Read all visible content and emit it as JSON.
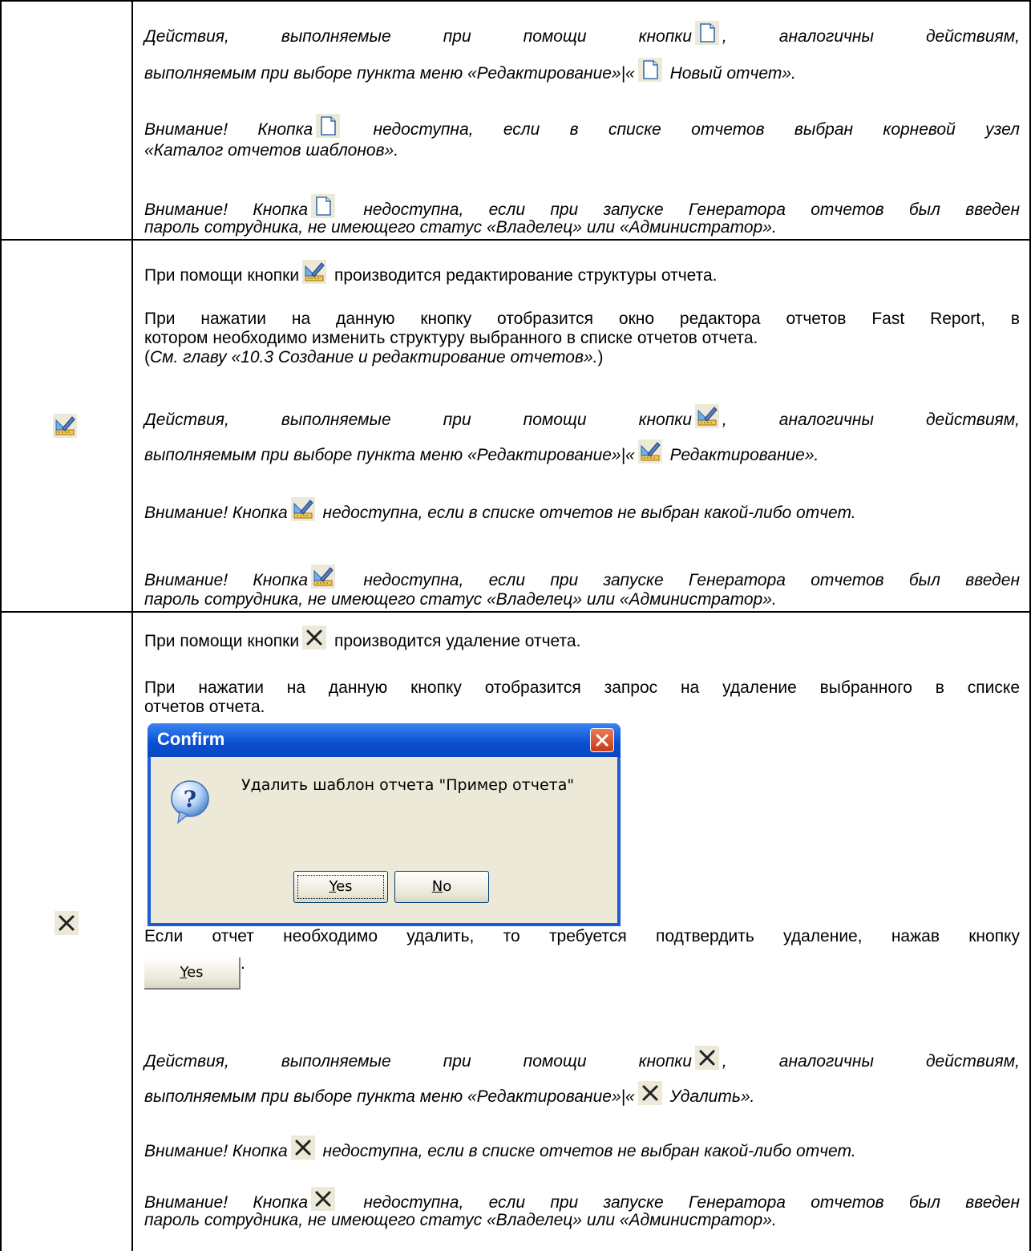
{
  "rows": [
    {
      "paragraphs": [
        {
          "a": "Действия, выполняемые при помощи кнопки",
          "b": ", аналогичны действиям,"
        },
        {
          "a": "выполняемым при выборе пункта меню «Редактирование»|«",
          "b": " Новый отчет»."
        },
        {
          "a": "Внимание! Кнопка",
          "b": " недоступна, если в списке отчетов выбран корневой узел"
        },
        {
          "a": "«Каталог отчетов шаблонов»."
        },
        {
          "a": "Внимание! Кнопка",
          "b": " недоступна, если при запуске Генератора отчетов был введен"
        },
        {
          "a": "пароль сотрудника, не имеющего статус «Владелец» или «Администратор»."
        }
      ],
      "icon": "new-report-icon"
    },
    {
      "paragraphs": [
        {
          "a": "При помощи кнопки",
          "b": " производится редактирование структуры отчета."
        },
        {
          "a": "При нажатии на данную кнопку отобразится окно редактора отчетов Fast Report, в"
        },
        {
          "a": "котором необходимо изменить структуру выбранного в списке отчетов отчета."
        },
        {
          "a": "(",
          "b": "См. главу «10.3 Создание и редактирование отчетов».",
          "c": ")"
        },
        {
          "a": "Действия, выполняемые при помощи кнопки",
          "b": ", аналогичны действиям,"
        },
        {
          "a": "выполняемым при выборе пункта меню «Редактирование»|«",
          "b": " Редактирование»."
        },
        {
          "a": "Внимание! Кнопка",
          "b": " недоступна, если в списке отчетов не выбран какой-либо отчет."
        },
        {
          "a": "Внимание! Кнопка",
          "b": " недоступна, если при запуске Генератора отчетов был введен"
        },
        {
          "a": "пароль сотрудника, не имеющего статус «Владелец» или «Администратор»."
        }
      ],
      "icon": "edit-report-icon"
    },
    {
      "paragraphs": [
        {
          "a": "При помощи кнопки",
          "b": " производится удаление отчета."
        },
        {
          "a": "При нажатии на данную кнопку отобразится запрос на удаление выбранного в списке"
        },
        {
          "a": "отчетов отчета."
        },
        {
          "a": "Если отчет необходимо удалить, то требуется подтвердить удаление, нажав кнопку"
        },
        {
          "a": "."
        },
        {
          "a": "Действия, выполняемые при помощи кнопки",
          "b": ", аналогичны действиям,"
        },
        {
          "a": "выполняемым при выборе пункта меню «Редактирование»|«",
          "b": " Удалить»."
        },
        {
          "a": "Внимание! Кнопка",
          "b": " недоступна, если в списке отчетов не выбран какой-либо отчет."
        },
        {
          "a": "Внимание! Кнопка",
          "b": " недоступна, если при запуске Генератора отчетов был введен"
        },
        {
          "a": "пароль сотрудника, не имеющего статус «Владелец» или «Администратор»."
        }
      ],
      "icon": "delete-icon"
    }
  ],
  "dialog": {
    "title": "Confirm",
    "message": "Удалить шаблон отчета \"Пример отчета\"",
    "yes": "Yes",
    "yes_mnemonic": "Y",
    "yes_rest": "es",
    "no_mnemonic": "N",
    "no_rest": "o",
    "icon": "question-icon"
  },
  "inline_button": {
    "mnemonic": "Y",
    "rest": "es"
  },
  "colors": {
    "border": "#000000",
    "xp_blue": "#0a4fd1",
    "dialog_face": "#ece9d8"
  }
}
